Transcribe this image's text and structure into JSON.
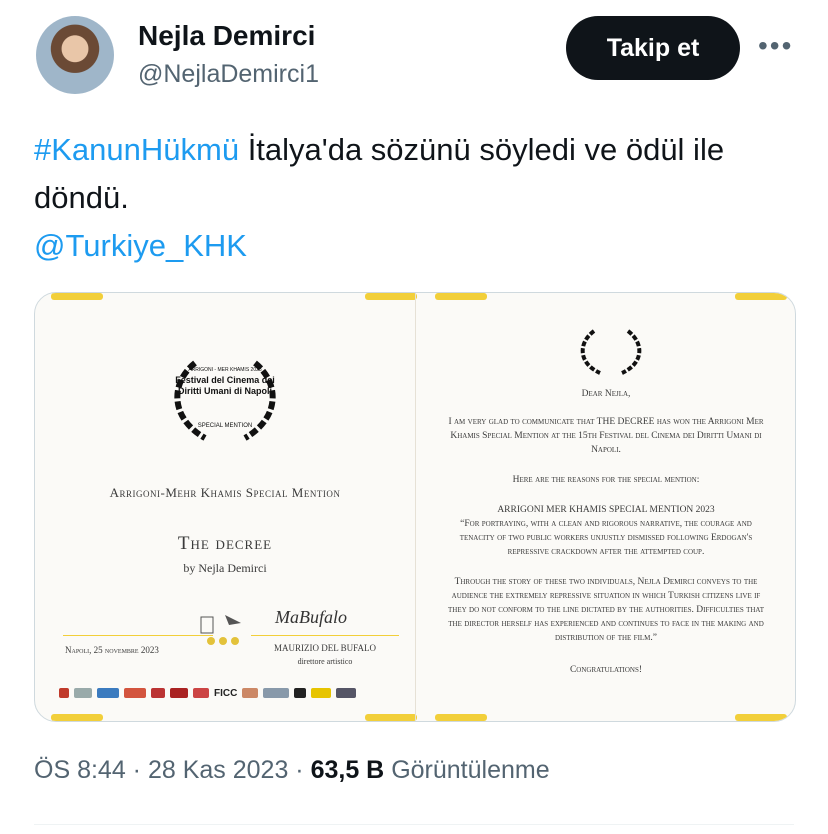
{
  "author": {
    "name": "Nejla Demirci",
    "handle": "@NejlaDemirci1",
    "follow_label": "Takip et",
    "more_icon": "more-horizontal-icon"
  },
  "tweet": {
    "hashtag": "#KanunHükmü",
    "text": " İtalya'da sözünü söyledi ve ödül ile döndü.",
    "mention": "@Turkiye_KHK"
  },
  "certificate": {
    "laurel_top": "ARRIGONI - MER KHAMIS 2023",
    "festival_name": "Festival del Cinema dei Diritti Umani di Napoli",
    "laurel_bottom": "SPECIAL MENTION",
    "award_title": "Arrigoni-Mehr Khamis Special Mention",
    "film_title": "The decree",
    "byline": "by Nejla Demirci",
    "place_date": "Napoli, 25 novembre 2023",
    "signature": "MaBufalo",
    "signer_name": "MAURIZIO DEL BUFALO",
    "signer_role": "direttore artistico",
    "logos": [
      "FICC"
    ]
  },
  "letter": {
    "greeting": "Dear Nejla,",
    "p1": "I am very glad to communicate that THE DECREE has won the Arrigoni Mer Khamis Special Mention at the 15th Festival del Cinema dei Diritti Umani di Napoli.",
    "p2": "Here are the reasons for the special mention:",
    "p3_title": "ARRIGONI MER KHAMIS SPECIAL MENTION 2023",
    "p3": "“For portraying, with a clean and rigorous narrative, the courage and tenacity of two public workers unjustly dismissed following Erdogan's repressive crackdown after the attempted coup.",
    "p4": "Through the story of these two individuals, Nejla Demirci conveys to the audience the extremely repressive situation in which Turkish citizens live if they do not conform to the line dictated by the authorities. Difficulties that the director herself has experienced and continues to face in the making and distribution of the film.”",
    "closing": "Congratulations!"
  },
  "meta": {
    "time": "ÖS 8:44",
    "date": "28 Kas 2023",
    "views_count": "63,5 B",
    "views_label": "Görüntülenme"
  },
  "colors": {
    "link": "#1d9bf0",
    "button": "#0f1419",
    "accent_yellow": "#f2cf3a"
  }
}
